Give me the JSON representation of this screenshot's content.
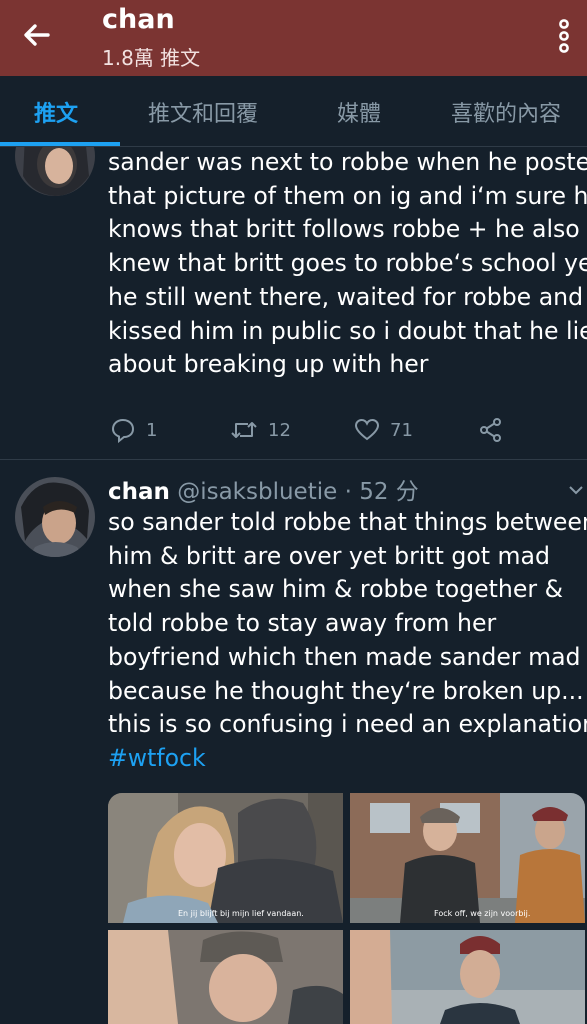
{
  "header": {
    "title": "chan",
    "subtitle": "1.8萬 推文"
  },
  "tabs": [
    {
      "label": "推文"
    },
    {
      "label": "推文和回覆"
    },
    {
      "label": "媒體"
    },
    {
      "label": "喜歡的內容"
    }
  ],
  "tweet1": {
    "lines": [
      "sander was next to robbe when he posted",
      "that picture of them on ig and i‘m sure he",
      "knows that britt follows robbe + he also",
      "knew that britt goes to robbe‘s school yet",
      "he still went there, waited for robbe and",
      "kissed him in public so i doubt that he lied",
      "about breaking up with her"
    ],
    "replies": "1",
    "retweets": "12",
    "likes": "71"
  },
  "tweet2": {
    "name": "chan",
    "handle": "@isaksbluetie",
    "time": "· 52 分",
    "lines": [
      "so sander told robbe that things between",
      "him & britt are over yet britt got mad",
      "when she saw him & robbe together &",
      "told robbe to stay away from her",
      "boyfriend which then made sander mad",
      "because he thought they‘re broken up...",
      "this is so confusing i need an explanation"
    ],
    "hashtag": "#wtfock",
    "media_captions": [
      "En jij blijft bij mijn lief vandaan.",
      "Fock off, we zijn voorbij."
    ]
  },
  "colors": {
    "header_bg": "#7b3432",
    "background": "#15202b",
    "accent": "#1da1f2",
    "muted": "#8899a6"
  },
  "icons": [
    "back-arrow-icon",
    "more-vertical-icon",
    "reply-icon",
    "retweet-icon",
    "like-icon",
    "share-icon",
    "chevron-down-icon"
  ]
}
